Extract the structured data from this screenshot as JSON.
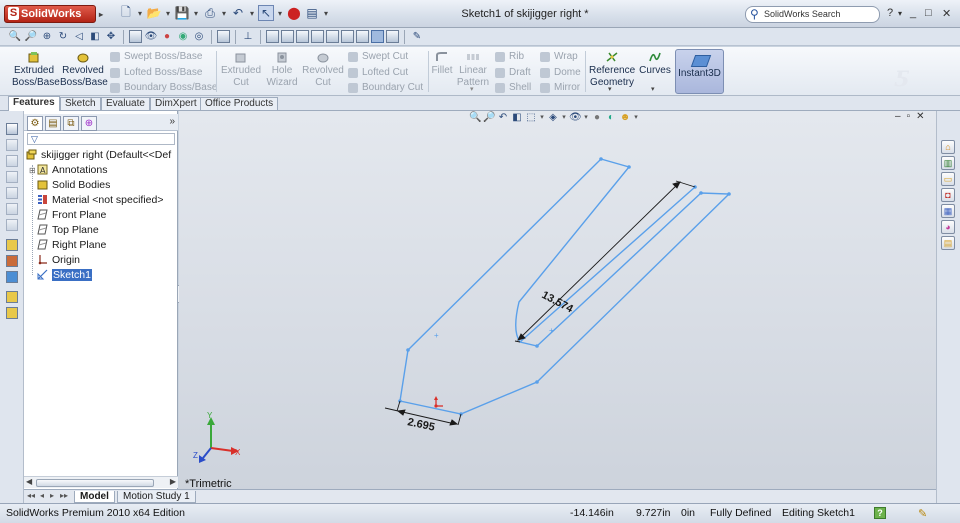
{
  "app": {
    "logo_text": "SolidWorks",
    "window_title": "Sketch1 of skijigger right *",
    "search_placeholder": "SolidWorks Search",
    "help_label": "?",
    "minimize_label": "_",
    "restore_label": "□",
    "close_label": "✕"
  },
  "command_manager": {
    "extruded_boss": "Extruded\nBoss/Base",
    "revolved_boss": "Revolved\nBoss/Base",
    "swept_boss": "Swept Boss/Base",
    "lofted_boss": "Lofted Boss/Base",
    "boundary_boss": "Boundary Boss/Base",
    "extruded_cut": "Extruded\nCut",
    "hole_wizard": "Hole\nWizard",
    "revolved_cut": "Revolved\nCut",
    "swept_cut": "Swept Cut",
    "lofted_cut": "Lofted Cut",
    "boundary_cut": "Boundary Cut",
    "fillet": "Fillet",
    "linear_pattern": "Linear\nPattern",
    "rib": "Rib",
    "draft": "Draft",
    "shell": "Shell",
    "wrap": "Wrap",
    "dome": "Dome",
    "mirror": "Mirror",
    "reference_geometry": "Reference\nGeometry",
    "curves": "Curves",
    "instant3d": "Instant3D"
  },
  "cm_tabs": [
    "Features",
    "Sketch",
    "Evaluate",
    "DimXpert",
    "Office Products"
  ],
  "feature_tree": {
    "root": "skijigger right  (Default<<Def",
    "items": [
      {
        "label": "Annotations",
        "icon": "annotations-icon",
        "expandable": true
      },
      {
        "label": "Solid Bodies",
        "icon": "solid-bodies-icon",
        "expandable": false
      },
      {
        "label": "Material <not specified>",
        "icon": "material-icon",
        "expandable": false
      },
      {
        "label": "Front Plane",
        "icon": "plane-icon",
        "expandable": false
      },
      {
        "label": "Top Plane",
        "icon": "plane-icon",
        "expandable": false
      },
      {
        "label": "Right Plane",
        "icon": "plane-icon",
        "expandable": false
      },
      {
        "label": "Origin",
        "icon": "origin-icon",
        "expandable": false
      },
      {
        "label": "Sketch1",
        "icon": "sketch-icon",
        "expandable": false,
        "selected": true
      }
    ],
    "expand_label": "»"
  },
  "graphics": {
    "view_label": "*Trimetric",
    "dim_long": "13.574",
    "dim_short": "2.695",
    "sketch_color": "#5aa0ea",
    "axis_x_color": "#d9302a",
    "axis_y_color": "#3aa83a",
    "axis_z_color": "#2a4cc9",
    "axis_x_label": "X",
    "axis_y_label": "Y",
    "axis_z_label": "Z"
  },
  "bottom_tabs": [
    "Model",
    "Motion Study 1"
  ],
  "status": {
    "product": "SolidWorks Premium 2010 x64 Edition",
    "x": "-14.146in",
    "y": "9.727in",
    "z": "0in",
    "state": "Fully Defined",
    "mode": "Editing Sketch1",
    "help": "?"
  }
}
